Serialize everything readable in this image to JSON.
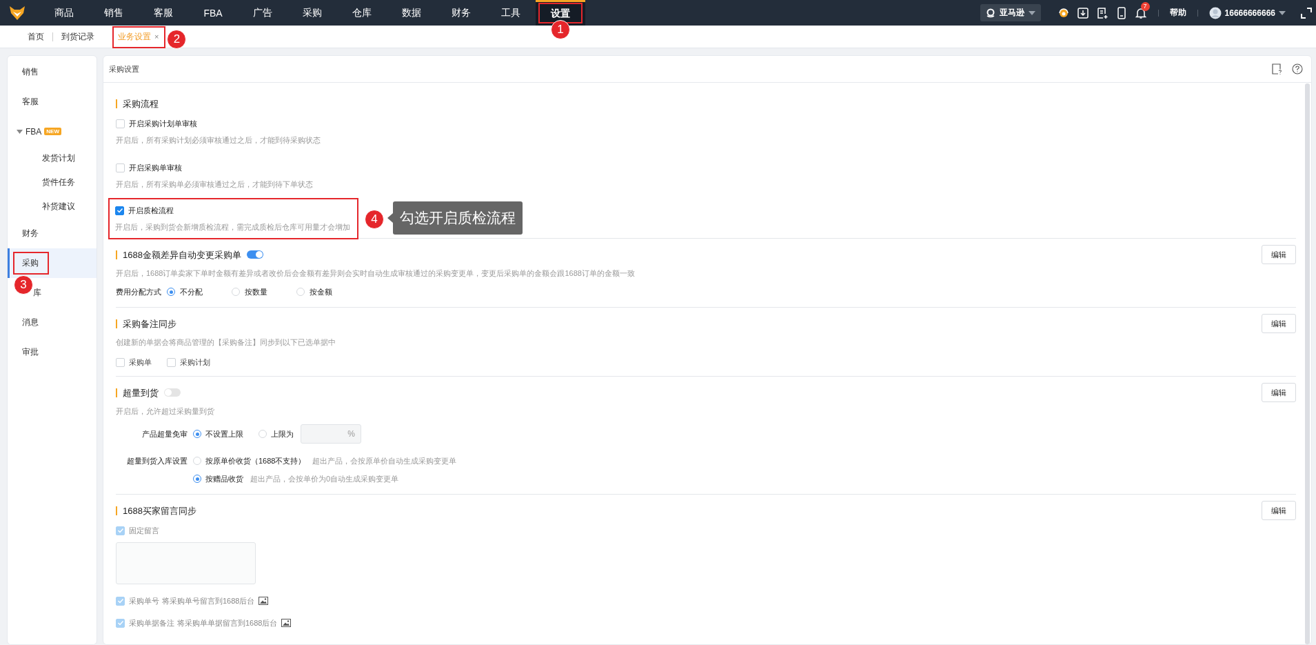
{
  "top_nav": {
    "items": [
      {
        "label": "商品",
        "selected": false
      },
      {
        "label": "销售",
        "selected": false
      },
      {
        "label": "客服",
        "selected": false
      },
      {
        "label": "FBA",
        "selected": false
      },
      {
        "label": "广告",
        "selected": false
      },
      {
        "label": "采购",
        "selected": false
      },
      {
        "label": "仓库",
        "selected": false
      },
      {
        "label": "数据",
        "selected": false
      },
      {
        "label": "财务",
        "selected": false
      },
      {
        "label": "工具",
        "selected": false
      },
      {
        "label": "设置",
        "selected": true,
        "marker": "1"
      }
    ],
    "marketplace": "亚马逊",
    "notification_count": "7",
    "help": "帮助",
    "user": "16666666666"
  },
  "page_tabs": [
    {
      "label": "首页",
      "selected": false,
      "closable": false
    },
    {
      "label": "到货记录",
      "selected": false,
      "closable": false
    },
    {
      "label": "业务设置",
      "selected": true,
      "closable": true,
      "close_label": "×",
      "marker": "2"
    }
  ],
  "sidebar": {
    "items": [
      {
        "label": "销售",
        "selected": false
      },
      {
        "label": "客服",
        "selected": false
      },
      {
        "label": "FBA",
        "selected": false,
        "badge": "NEW",
        "expanded": true,
        "children": [
          {
            "label": "发货计划",
            "selected": false
          },
          {
            "label": "货件任务",
            "selected": false
          },
          {
            "label": "补货建议",
            "selected": false
          }
        ]
      },
      {
        "label": "财务",
        "selected": false
      },
      {
        "label": "采购",
        "selected": true,
        "marker": "3"
      },
      {
        "label": "库",
        "selected": false
      },
      {
        "label": "消息",
        "selected": false
      },
      {
        "label": "审批",
        "selected": false
      }
    ]
  },
  "panel": {
    "title": "采购设置",
    "sections": [
      {
        "title": "采购流程",
        "rows": [
          {
            "kind": "option",
            "label": "开启采购计划单审核",
            "checked": false,
            "description": "开启后，所有采购计划必须审核通过之后，才能到待采购状态"
          },
          {
            "kind": "option",
            "label": "开启采购单审核",
            "checked": false,
            "description": "开启后，所有采购单必须审核通过之后，才能到待下单状态"
          },
          {
            "kind": "option",
            "label": "开启质检流程",
            "checked": true,
            "description": "开启后，采购到货会新增质检流程，需完成质检后仓库可用量才会增加",
            "marker": "4",
            "callout": "勾选开启质检流程"
          }
        ]
      },
      {
        "title": "1688金额差异自动变更采购单",
        "toggle": true,
        "edit_button": "编辑",
        "rows": [
          {
            "kind": "text",
            "text": "开启后，1688订单卖家下单时金额有差异或者改价后会金额有差异则会实时自动生成审核通过的采购变更单，变更后采购单的金额会跟1688订单的金额一致"
          },
          {
            "kind": "radio_inline",
            "label": "费用分配方式",
            "options": [
              {
                "label": "不分配",
                "selected": true
              },
              {
                "label": "按数量",
                "selected": false
              },
              {
                "label": "按金额",
                "selected": false
              }
            ]
          }
        ]
      },
      {
        "title": "采购备注同步",
        "edit_button": "编辑",
        "rows": [
          {
            "kind": "text",
            "text": "创建新的单据会将商品管理的【采购备注】同步到以下已选单据中"
          },
          {
            "kind": "checkbox_inline",
            "options": [
              {
                "label": "采购单",
                "checked": false
              },
              {
                "label": "采购计划",
                "checked": false
              }
            ]
          }
        ]
      },
      {
        "title": "超量到货",
        "toggle": false,
        "edit_button": "编辑",
        "rows": [
          {
            "kind": "text",
            "text": "开启后，允许超过采购量到货"
          },
          {
            "kind": "form_radio",
            "label": "产品超量免审",
            "stacked": false,
            "options": [
              {
                "label": "不设置上限",
                "selected": true
              },
              {
                "label": "上限为",
                "selected": false,
                "input_suffix": "%"
              }
            ]
          },
          {
            "kind": "form_radio",
            "label": "超量到货入库设置",
            "stacked": true,
            "options": [
              {
                "label": "按原单价收货（1688不支持）",
                "selected": false,
                "hint": "超出产品，会按原单价自动生成采购变更单"
              },
              {
                "label": "按赠品收货",
                "selected": true,
                "hint": "超出产品，会按单价为0自动生成采购变更单"
              }
            ]
          }
        ]
      },
      {
        "title": "1688买家留言同步",
        "edit_button": "编辑",
        "rows": [
          {
            "kind": "disabled_check",
            "label": "固定留言",
            "checked": true
          },
          {
            "kind": "textarea"
          },
          {
            "kind": "disabled_check",
            "label": "采购单号",
            "note": "将采购单号留言到1688后台",
            "checked": true,
            "preview": true
          },
          {
            "kind": "disabled_check",
            "label": "采购单据备注",
            "note": "将采购单单据留言到1688后台",
            "checked": true,
            "preview": true
          }
        ]
      }
    ]
  }
}
